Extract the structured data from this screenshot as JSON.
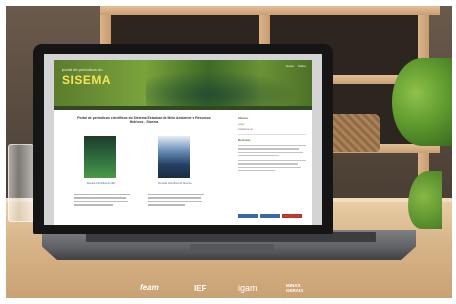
{
  "website": {
    "logo_small": "portal de periódicos do",
    "logo_big": "SISEMA",
    "top_nav": [
      "Home",
      "Sobre"
    ],
    "headline": "Portal de periódicos científicos do Sistema Estadual de Meio Ambiente e Recursos Hídricos - Sisema",
    "covers": [
      {
        "caption": "Revista Científica do IEF"
      },
      {
        "caption": "Revista Científica do Sisema"
      }
    ],
    "sidebar": {
      "title": "Idioma",
      "links": [
        "Login",
        "Cadastrar-se"
      ],
      "section_title": "Revistas",
      "button_colors": [
        "#3a6aa6",
        "#3a6aa6",
        "#c0392b"
      ]
    }
  },
  "footer_logos": [
    {
      "label": "feam",
      "icon": "feam-logo"
    },
    {
      "label": "IEF",
      "icon": "ief-logo"
    },
    {
      "label": "igam",
      "icon": "igam-logo"
    },
    {
      "label": "MINAS GERAIS",
      "icon": "minas-gerais-logo"
    }
  ],
  "colors": {
    "banner_green": "#5b7c2e",
    "logo_yellow": "#f7e35a",
    "nav_dark": "#2f4a1f",
    "link_blue": "#3a6aa6"
  }
}
